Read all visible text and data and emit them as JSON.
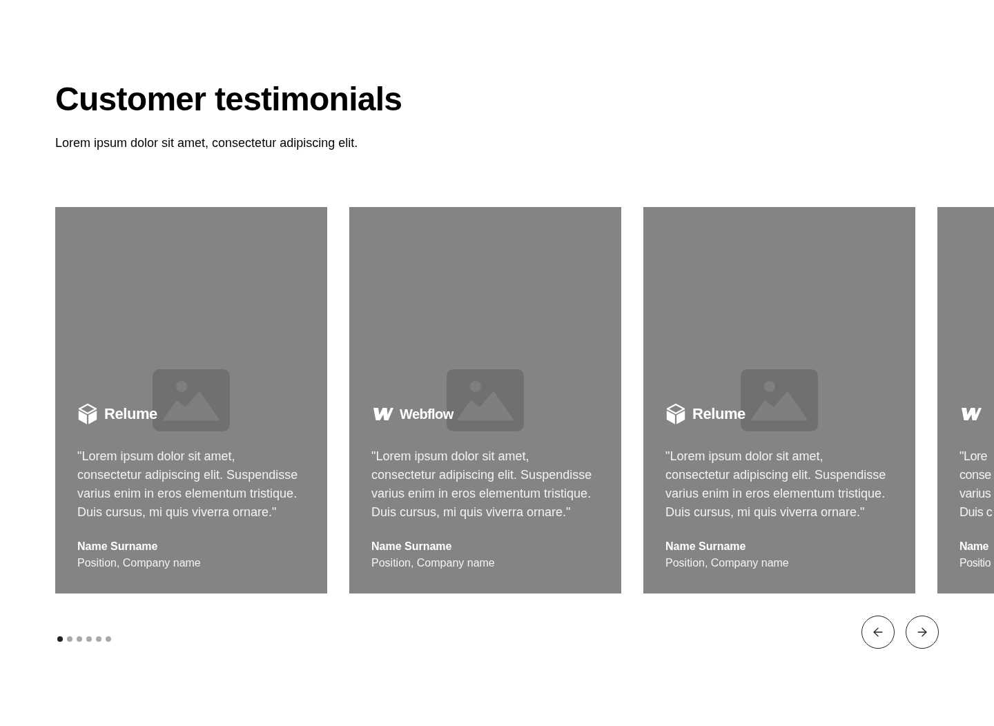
{
  "heading": "Customer testimonials",
  "subheading": "Lorem ipsum dolor sit amet, consectetur adipiscing elit.",
  "cards": [
    {
      "kind": "full",
      "logo": {
        "kind": "cube",
        "name": "Relume"
      },
      "quote": "\"Lorem ipsum dolor sit amet, consectetur adipiscing elit. Suspendisse varius enim in eros elementum tristique. Duis cursus, mi quis viverra ornare.\"",
      "name": "Name Surname",
      "position": "Position, Company name"
    },
    {
      "kind": "full",
      "logo": {
        "kind": "wmark",
        "name": "Webflow"
      },
      "quote": "\"Lorem ipsum dolor sit amet, consectetur adipiscing elit. Suspendisse varius enim in eros elementum tristique. Duis cursus, mi quis viverra ornare.\"",
      "name": "Name Surname",
      "position": "Position, Company name"
    },
    {
      "kind": "full",
      "logo": {
        "kind": "cube",
        "name": "Relume"
      },
      "quote": "\"Lorem ipsum dolor sit amet, consectetur adipiscing elit. Suspendisse varius enim in eros elementum tristique. Duis cursus, mi quis viverra ornare.\"",
      "name": "Name Surname",
      "position": "Position, Company name"
    },
    {
      "kind": "clipped",
      "logo": {
        "kind": "wmark"
      },
      "quote_lines": [
        "\"Lore",
        "conse",
        "varius",
        "Duis c"
      ],
      "name": "Name",
      "position": "Positio"
    }
  ],
  "pagination": [
    {
      "selected": true
    },
    {
      "selected": false
    },
    {
      "selected": false
    },
    {
      "selected": false
    },
    {
      "selected": false
    },
    {
      "selected": false
    }
  ],
  "controls": [
    {
      "kind": "previous"
    },
    {
      "kind": "next"
    }
  ]
}
